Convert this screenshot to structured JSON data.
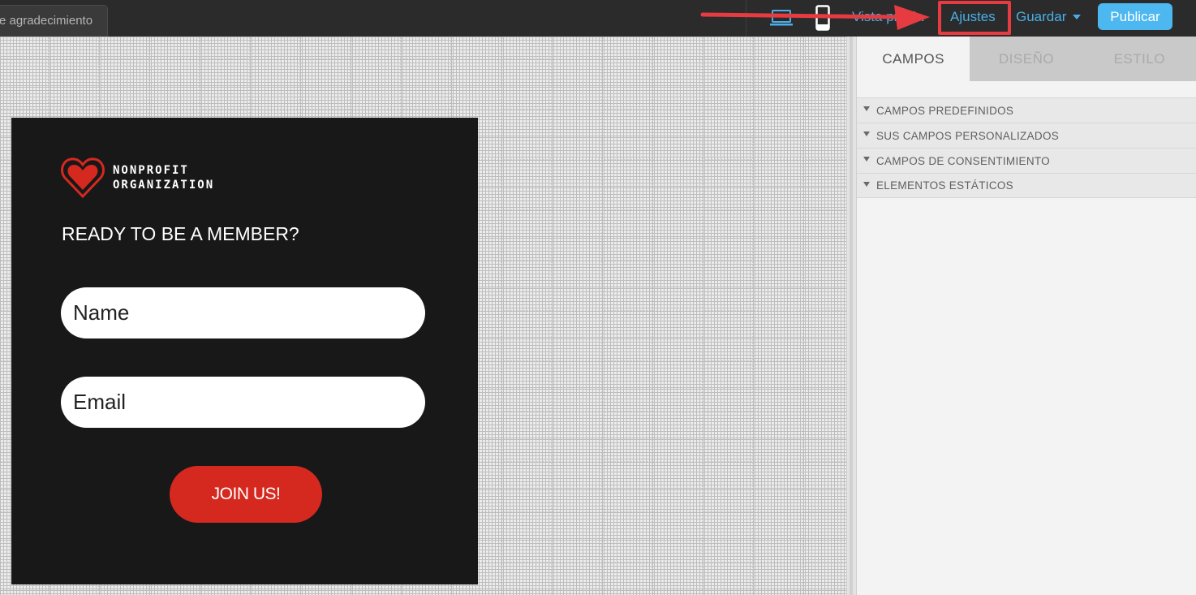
{
  "topbar": {
    "partial_tab": "e agradecimiento",
    "preview_label": "Vista previa",
    "settings_label": "Ajustes",
    "save_label": "Guardar",
    "publish_label": "Publicar",
    "icons": [
      "desktop-icon",
      "mobile-icon",
      "caret-down-icon"
    ],
    "accent_color": "#4aaee8",
    "publish_color": "#4db7f0",
    "highlight_color": "#e53b41"
  },
  "form": {
    "logo_line1": "NONPROFIT",
    "logo_line2": "ORGANIZATION",
    "heading": "READY TO BE A MEMBER?",
    "name_placeholder": "Name",
    "email_placeholder": "Email",
    "button_label": "JOIN US!",
    "card_color": "#181818",
    "button_color": "#d5291f"
  },
  "panel": {
    "tabs": [
      {
        "label": "CAMPOS",
        "active": true
      },
      {
        "label": "DISEÑO",
        "active": false
      },
      {
        "label": "ESTILO",
        "active": false
      }
    ],
    "sections": [
      {
        "label": "CAMPOS PREDEFINIDOS"
      },
      {
        "label": "SUS CAMPOS PERSONALIZADOS"
      },
      {
        "label": "CAMPOS DE CONSENTIMIENTO"
      },
      {
        "label": "ELEMENTOS ESTÁTICOS"
      }
    ]
  }
}
